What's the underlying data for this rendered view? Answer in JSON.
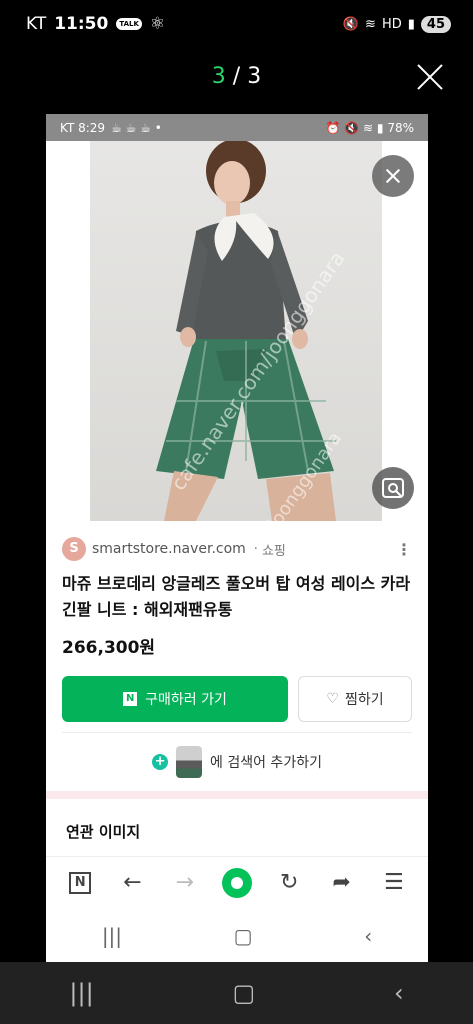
{
  "status_bar": {
    "carrier": "KT",
    "time": "11:50",
    "talk_icon": "TALK",
    "battery": "45"
  },
  "viewer": {
    "current": "3",
    "separator": " / ",
    "total": "3"
  },
  "inner_status": {
    "carrier": "KT",
    "time": "8:29",
    "battery": "78%"
  },
  "watermark": {
    "line1": "cafe.naver.com/joonggonara",
    "line2": "joonggonara"
  },
  "result": {
    "favicon_letter": "S",
    "domain": "smartstore.naver.com",
    "separator": "·",
    "category": "쇼핑",
    "title": "마쥬 브로데리 앙글레즈 풀오버 탑 여성 레이스 카라 긴팔 니트 : 해외재팬유통",
    "price": "266,300원",
    "buy_label": "구매하러 가기",
    "buy_badge": "N",
    "wish_label": "찜하기",
    "add_search_label": "에 검색어 추가하기",
    "related_title": "연관 이미지"
  },
  "browser_bar": {
    "n_label": "N"
  },
  "colors": {
    "accent_green": "#04b25a",
    "counter_green": "#2fd36b"
  }
}
